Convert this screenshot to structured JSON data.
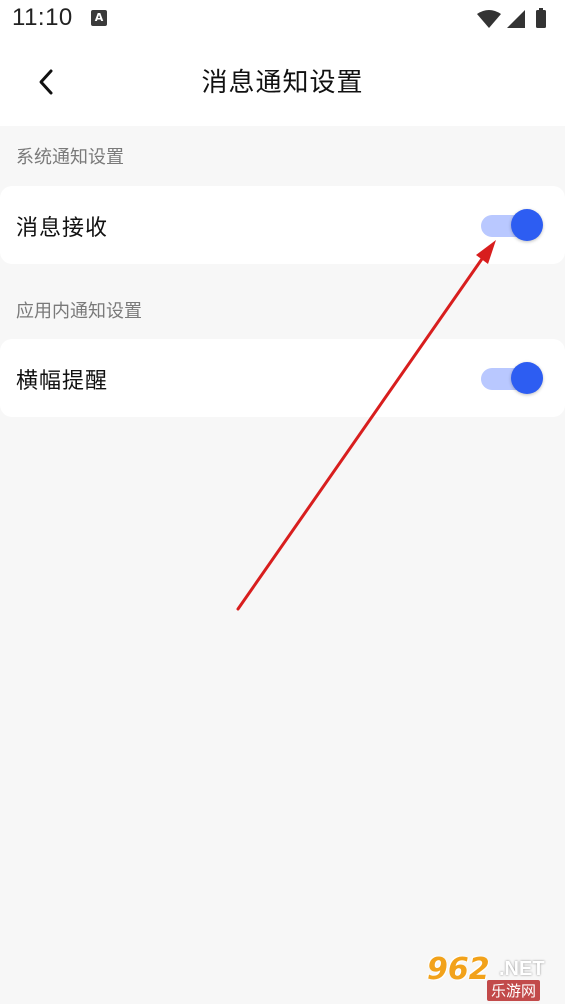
{
  "status_bar": {
    "time": "11:10",
    "notification_icon": "A"
  },
  "header": {
    "back_icon": "chevron-left-icon",
    "title": "消息通知设置"
  },
  "sections": [
    {
      "label": "系统通知设置",
      "rows": [
        {
          "label": "消息接收",
          "enabled": true
        }
      ]
    },
    {
      "label": "应用内通知设置",
      "rows": [
        {
          "label": "横幅提醒",
          "enabled": true
        }
      ]
    }
  ],
  "colors": {
    "accent": "#2d5df2",
    "toggle_track": "#b9c8ff",
    "annotation_arrow": "#d81e1e"
  },
  "watermark": {
    "main": "962",
    "suffix": ".NET",
    "sub": "乐游网"
  }
}
